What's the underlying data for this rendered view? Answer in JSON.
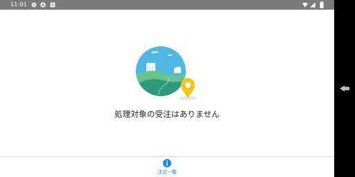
{
  "status_bar": {
    "time": "11:01",
    "icons": [
      "settings-gear-icon",
      "a-circle-icon",
      "square-notification-icon",
      "wifi-icon",
      "cell-signal-icon",
      "battery-icon"
    ]
  },
  "main": {
    "empty_message": "処理対象の受注はありません",
    "illustration": "map-location-pin-illustration"
  },
  "bottom_nav": {
    "tabs": [
      {
        "label": "注文一覧",
        "icon": "info-circle-icon",
        "active": true
      }
    ]
  },
  "system_nav": {
    "back_icon": "back-triangle-icon"
  },
  "colors": {
    "status_bar": "#7a7a7a",
    "accent": "#1e88e5",
    "sky": "#4fb7e6",
    "hill_dark": "#2e9a7b",
    "hill_light": "#67c38d",
    "pin": "#f5c518"
  }
}
